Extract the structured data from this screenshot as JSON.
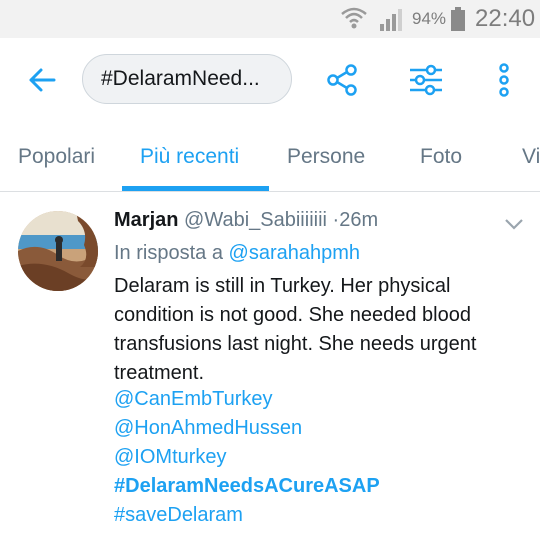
{
  "status_bar": {
    "battery_percent": "94%",
    "time": "22:40",
    "icons": [
      "wifi-icon",
      "signal-icon",
      "battery-icon"
    ]
  },
  "toolbar": {
    "back_icon": "arrow-left-icon",
    "search_text": "#DelaramNeed...",
    "share_icon": "share-icon",
    "filter_icon": "sliders-icon",
    "more_icon": "more-vertical-icon"
  },
  "tabs": [
    {
      "label": "Popolari",
      "active": false
    },
    {
      "label": "Più recenti",
      "active": true
    },
    {
      "label": "Persone",
      "active": false
    },
    {
      "label": "Foto",
      "active": false
    },
    {
      "label": "Vi",
      "active": false
    }
  ],
  "tweet": {
    "author_name": "Marjan",
    "author_handle": "@Wabi_Sabiiiiiii",
    "separator": "·",
    "time": "26m",
    "reply_prefix": "In risposta a",
    "reply_to": "@sarahahpmh",
    "text_lines": [
      "Delaram is still in Turkey.  Her physical",
      "condition is not good.  She needed blood",
      "transfusions last night. She needs urgent",
      "treatment."
    ],
    "mentions": [
      "@CanEmbTurkey",
      "@HonAhmedHussen",
      "@IOMturkey"
    ],
    "hashtags": [
      "#DelaramNeedsACureASAP",
      "#saveDelaram"
    ]
  },
  "colors": {
    "accent": "#1da1f2",
    "secondary_text": "#657786",
    "primary_text": "#14171a",
    "status_bar_bg": "#f2f2f2"
  }
}
